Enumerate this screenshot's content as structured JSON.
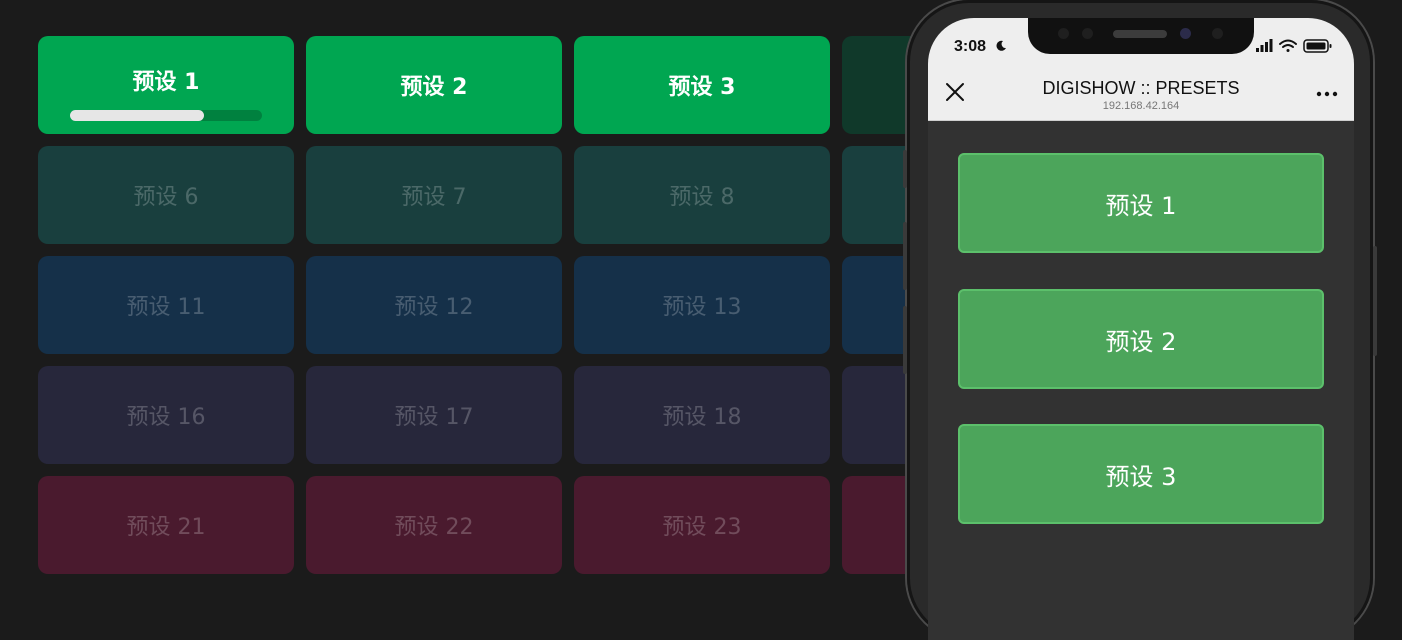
{
  "colors": {
    "row1_active": "#00a651",
    "row1_inactive": "#10392a",
    "row2": "#193f3e",
    "row3": "#153049",
    "row4": "#27273b",
    "row5": "#4a1a2e"
  },
  "grid": {
    "rows": [
      {
        "color_key": "row1",
        "tiles": [
          {
            "label": "预设 1",
            "active": true,
            "progress": 0.7
          },
          {
            "label": "预设 2",
            "active": true
          },
          {
            "label": "预设 3",
            "active": true
          },
          {
            "label": "",
            "active": false
          }
        ]
      },
      {
        "color_key": "row2",
        "tiles": [
          {
            "label": "预设 6",
            "active": false
          },
          {
            "label": "预设 7",
            "active": false
          },
          {
            "label": "预设 8",
            "active": false
          },
          {
            "label": "",
            "active": false
          }
        ]
      },
      {
        "color_key": "row3",
        "tiles": [
          {
            "label": "预设 11",
            "active": false
          },
          {
            "label": "预设 12",
            "active": false
          },
          {
            "label": "预设 13",
            "active": false
          },
          {
            "label": "",
            "active": false
          }
        ]
      },
      {
        "color_key": "row4",
        "tiles": [
          {
            "label": "预设 16",
            "active": false
          },
          {
            "label": "预设 17",
            "active": false
          },
          {
            "label": "预设 18",
            "active": false
          },
          {
            "label": "",
            "active": false
          }
        ]
      },
      {
        "color_key": "row5",
        "tiles": [
          {
            "label": "预设 21",
            "active": false
          },
          {
            "label": "预设 22",
            "active": false
          },
          {
            "label": "预设 23",
            "active": false
          },
          {
            "label": "",
            "active": false
          }
        ]
      }
    ]
  },
  "phone": {
    "status": {
      "time": "3:08"
    },
    "nav": {
      "title": "DIGISHOW :: PRESETS",
      "subtitle": "192.168.42.164",
      "close_icon": "close-icon",
      "more_icon": "more-icon"
    },
    "buttons": [
      {
        "label": "预设 1"
      },
      {
        "label": "预设 2"
      },
      {
        "label": "预设 3"
      }
    ]
  }
}
